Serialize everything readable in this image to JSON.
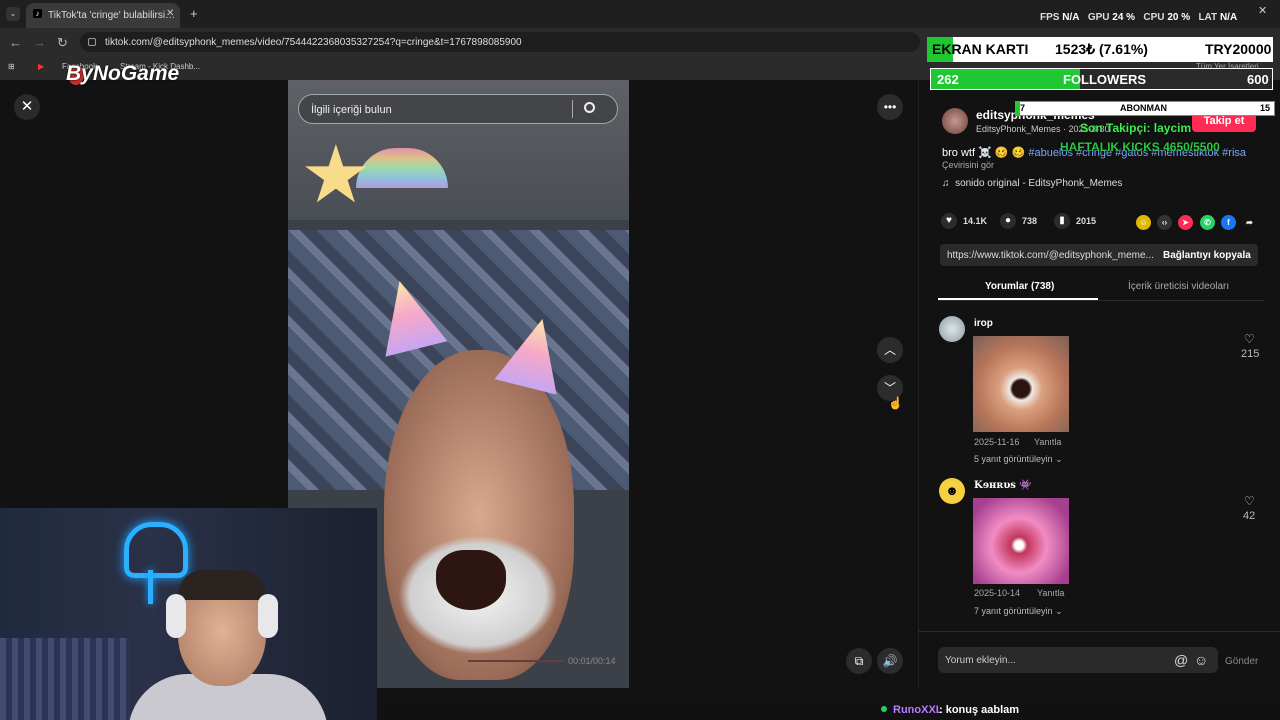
{
  "browser": {
    "tab_title": "TikTok'ta 'cringe' bulabilirsi…",
    "url": "tiktok.com/@editsyphonk_memes/video/7544422368035327254?q=cringe&t=1767898085900",
    "bookmarks": [
      "Facebook",
      "Stream - Kick Dashb..."
    ],
    "all_bookmarks": "Tüm Yer İşaretleri"
  },
  "hud": {
    "fps_label": "FPS",
    "fps_value": "N/A",
    "gpu_label": "GPU",
    "gpu_value": "24 %",
    "cpu_label": "CPU",
    "cpu_value": "20 %",
    "lat_label": "LAT",
    "lat_value": "N/A"
  },
  "overlay": {
    "logo": "ByNoGame",
    "ekran_label": "EKRAN KARTI",
    "ekran_value": "1523₺ (7.61%)",
    "ekran_goal": "TRY20000",
    "ekran_progress": 0.0761,
    "followers_current": "262",
    "followers_label": "FOLLOWERS",
    "followers_goal": "600",
    "followers_progress": 0.437,
    "abonman_current": "7",
    "abonman_label": "ABONMAN",
    "abonman_goal": "15",
    "son_takipci": "Son Takipçi: laycim",
    "haftalik": "HAFTALIK KICKS 4650/5500"
  },
  "video": {
    "search_placeholder": "İlgili içeriği bulun",
    "time": "00:01/00:14"
  },
  "post": {
    "username": "editsyphonk_memes",
    "subline": "EditsyPhonk_Memes · 2025-8-30",
    "follow_label": "Takip et",
    "caption_text": "bro wtf ☠️ 🥴 🥴",
    "caption_tags": "#abuelos #cringe #gatos #memestiktok #risa",
    "translate": "Çevirisini gör",
    "music": "sonido original - EditsyPhonk_Memes",
    "likes": "14.1K",
    "comments": "738",
    "saves": "2015",
    "link": "https://www.tiktok.com/@editsyphonk_meme...",
    "copy_label": "Bağlantıyı kopyala",
    "tab_comments": "Yorumlar (738)",
    "tab_creator": "İçerik üreticisi videoları"
  },
  "comments": [
    {
      "user": "irop",
      "date": "2025-11-16",
      "reply": "Yanıtla",
      "more": "5 yanıt görüntüleyin",
      "likes": "215"
    },
    {
      "user": "Kɘʜʀυs 👾",
      "date": "2025-10-14",
      "reply": "Yanıtla",
      "more": "7 yanıt görüntüleyin",
      "likes": "42"
    }
  ],
  "composer": {
    "placeholder": "Yorum ekleyin...",
    "send": "Gönder"
  },
  "chat": {
    "name": "RunoXXL",
    "message": ": konuş aablam"
  }
}
